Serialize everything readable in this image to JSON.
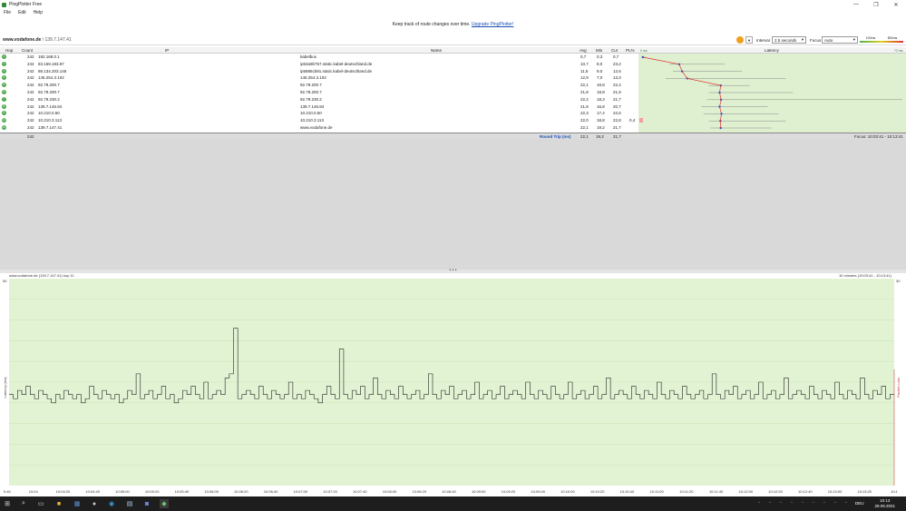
{
  "window": {
    "title": "PingPlotter Free",
    "controls": [
      "—",
      "❐",
      "✕"
    ]
  },
  "menu": [
    "File",
    "Edit",
    "Help"
  ],
  "promo": {
    "text": "Keep track of route changes over time.",
    "link": "Upgrade PingPlotter!"
  },
  "target": {
    "name": "www.vodafone.de",
    "ip": "/ 139.7.147.41",
    "interval_label": "Interval",
    "interval_value": "2.5 seconds",
    "focus_label": "Focus",
    "focus_value": "Auto",
    "legend_low": "100ms",
    "legend_high": "800ms"
  },
  "hop_table": {
    "headers": {
      "hop": "Hop",
      "count": "Count",
      "ip": "IP",
      "name": "Name",
      "avg": "Avg",
      "min": "Min",
      "cur": "Cur",
      "pl": "PL%",
      "latency": "Latency"
    },
    "scale_left": "0 ms",
    "scale_right": "72 ms",
    "rows": [
      {
        "hop": "1",
        "count": "242",
        "ip": "192.168.0.1",
        "name": "kabelbox",
        "avg": "0,7",
        "min": "0,3",
        "cur": "0,7",
        "pl": "",
        "avg_ms": 0.7,
        "min_ms": 0.3,
        "max_ms": 1.5
      },
      {
        "hop": "2",
        "count": "242",
        "ip": "83.169.183.87",
        "name": "ip53a9b757.static.kabel-deutschland.de",
        "avg": "10,7",
        "min": "8,0",
        "cur": "23,2",
        "pl": "",
        "avg_ms": 10.7,
        "min_ms": 8.0,
        "max_ms": 23.2
      },
      {
        "hop": "3",
        "count": "242",
        "ip": "88.134.203.145",
        "name": "ip5886cb91.static.kabel-deutschland.de",
        "avg": "11,5",
        "min": "9,0",
        "cur": "12,6",
        "pl": "",
        "avg_ms": 11.5,
        "min_ms": 9.0,
        "max_ms": 28.0
      },
      {
        "hop": "4",
        "count": "242",
        "ip": "145.254.3.102",
        "name": "145.254.3.102",
        "avg": "12,9",
        "min": "7,0",
        "cur": "13,3",
        "pl": "",
        "avg_ms": 12.9,
        "min_ms": 7.0,
        "max_ms": 40.0
      },
      {
        "hop": "5",
        "count": "242",
        "ip": "92.79.200.7",
        "name": "92.79.200.7",
        "avg": "22,1",
        "min": "18,8",
        "cur": "22,4",
        "pl": "",
        "avg_ms": 22.1,
        "min_ms": 18.8,
        "max_ms": 30.0
      },
      {
        "hop": "6",
        "count": "242",
        "ip": "92.79.200.7",
        "name": "92.79.200.7",
        "avg": "21,8",
        "min": "18,8",
        "cur": "21,9",
        "pl": "",
        "avg_ms": 21.8,
        "min_ms": 18.8,
        "max_ms": 42.0
      },
      {
        "hop": "7",
        "count": "242",
        "ip": "92.79.230.2",
        "name": "92.79.230.2",
        "avg": "22,2",
        "min": "18,3",
        "cur": "21,7",
        "pl": "",
        "avg_ms": 22.2,
        "min_ms": 18.3,
        "max_ms": 72.0
      },
      {
        "hop": "8",
        "count": "242",
        "ip": "139.7.146.84",
        "name": "139.7.146.84",
        "avg": "21,8",
        "min": "16,8",
        "cur": "20,7",
        "pl": "",
        "avg_ms": 21.8,
        "min_ms": 16.8,
        "max_ms": 35.0
      },
      {
        "hop": "9",
        "count": "242",
        "ip": "10.210.0.50",
        "name": "10.210.0.50",
        "avg": "22,3",
        "min": "17,4",
        "cur": "22,6",
        "pl": "",
        "avg_ms": 22.3,
        "min_ms": 17.4,
        "max_ms": 38.0
      },
      {
        "hop": "10",
        "count": "242",
        "ip": "10.210.3.113",
        "name": "10.210.3.113",
        "avg": "22,0",
        "min": "18,8",
        "cur": "22,8",
        "pl": "0,4",
        "avg_ms": 22.0,
        "min_ms": 18.8,
        "max_ms": 40.0
      },
      {
        "hop": "11",
        "count": "242",
        "ip": "139.7.147.41",
        "name": "www.vodafone.de",
        "avg": "22,1",
        "min": "19,2",
        "cur": "21,7",
        "pl": "",
        "avg_ms": 22.1,
        "min_ms": 19.2,
        "max_ms": 36.0
      }
    ],
    "summary": {
      "count": "242",
      "label": "Round Trip (ms)",
      "avg": "22,1",
      "min": "19,2",
      "cur": "21,7",
      "focus": "Focus: 10:03:41 - 10:13:41"
    }
  },
  "graph": {
    "title": "www.vodafone.de (139.7.147.41) hop 11",
    "range": "10 minutes (10:03:41 - 10:13:41)",
    "ylabel_left": "Latency (ms)",
    "ylabel_right": "Packet Loss",
    "ytop": "50",
    "ytop_right": "30",
    "grid_color": "#cde6b8",
    "bg_color": "#e2f3d4",
    "line_color": "#222222"
  },
  "chart_data": {
    "type": "line",
    "ylabel": "Latency (ms)",
    "ylim": [
      0,
      50
    ],
    "x_ticks": [
      "0:40",
      "10:04",
      "10:04:20",
      "10:04:40",
      "10:05:00",
      "10:05:20",
      "10:05:40",
      "10:06:00",
      "10:06:20",
      "10:06:40",
      "10:07:00",
      "10:07:20",
      "10:07:40",
      "10:08:00",
      "10:08:20",
      "10:08:40",
      "10:09:00",
      "10:09:20",
      "10:09:40",
      "10:10:00",
      "10:10:20",
      "10:10:40",
      "10:11:00",
      "10:11:20",
      "10:11:40",
      "10:12:00",
      "10:12:20",
      "10:12:40",
      "10:13:00",
      "10:13:20",
      "10:1"
    ],
    "values": [
      22,
      21,
      23,
      22,
      24,
      22,
      21,
      23,
      22,
      21,
      20,
      22,
      21,
      23,
      22,
      21,
      22,
      20,
      21,
      24,
      22,
      21,
      23,
      22,
      21,
      22,
      20,
      21,
      23,
      22,
      27,
      21,
      22,
      23,
      21,
      22,
      24,
      21,
      22,
      20,
      21,
      23,
      22,
      24,
      22,
      21,
      25,
      21,
      22,
      23,
      22,
      26,
      27,
      38,
      21,
      22,
      23,
      22,
      21,
      24,
      22,
      21,
      23,
      22,
      21,
      22,
      25,
      21,
      22,
      21,
      23,
      22,
      21,
      20,
      22,
      24,
      22,
      21,
      33,
      22,
      21,
      23,
      22,
      24,
      21,
      22,
      26,
      22,
      21,
      23,
      22,
      21,
      24,
      22,
      21,
      22,
      23,
      21,
      22,
      27,
      22,
      21,
      23,
      22,
      24,
      21,
      22,
      23,
      21,
      22,
      25,
      21,
      22,
      23,
      21,
      22,
      24,
      21,
      22,
      23,
      22,
      21,
      25,
      22,
      21,
      23,
      22,
      21,
      24,
      22,
      21,
      22,
      25,
      21,
      22,
      23,
      21,
      22,
      24,
      21,
      22,
      26,
      21,
      22,
      23,
      22,
      21,
      24,
      22,
      21,
      23,
      22,
      21,
      25,
      22,
      21,
      23,
      22,
      21,
      24,
      22,
      21,
      22,
      23,
      21,
      22,
      27,
      22,
      21,
      23,
      22,
      24,
      21,
      22,
      23,
      21,
      22,
      25,
      21,
      22,
      23,
      21,
      22,
      26,
      21,
      22,
      23,
      22,
      21,
      24,
      22,
      21,
      23,
      22,
      21,
      25,
      22,
      21,
      23,
      22,
      21,
      26,
      22,
      21,
      23,
      22,
      24,
      21,
      22
    ]
  },
  "taskbar": {
    "time": "10:13",
    "date": "28.09.2021",
    "lang": "DEU"
  }
}
